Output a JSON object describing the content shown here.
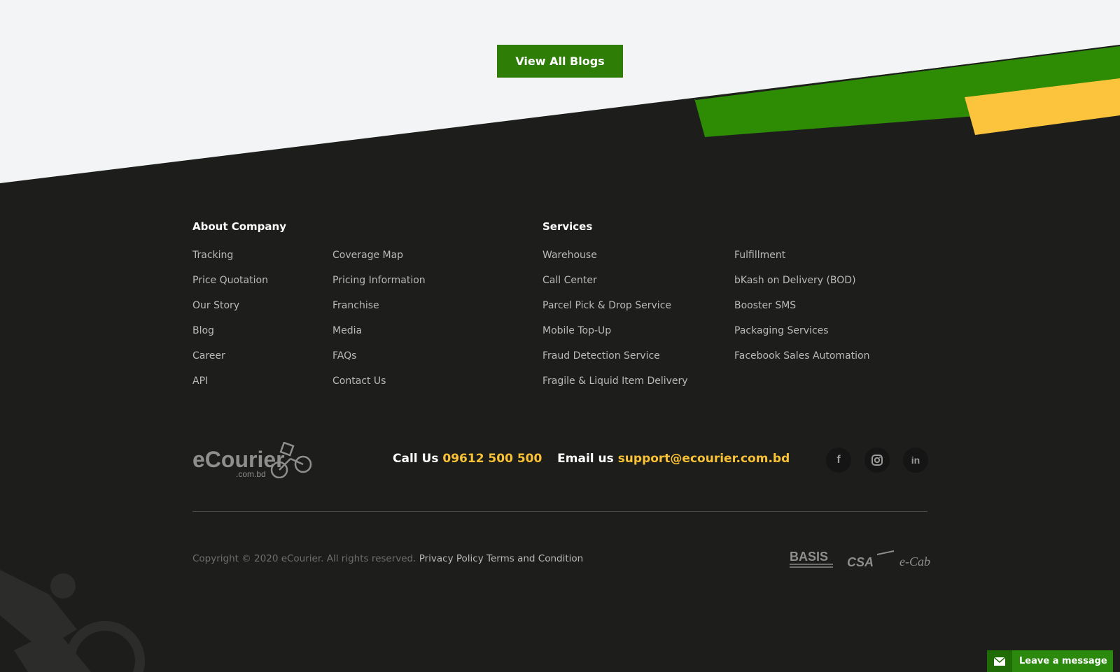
{
  "top_button": {
    "label": "View All Blogs"
  },
  "about": {
    "heading": "About Company",
    "col1": [
      "Tracking",
      "Price Quotation",
      "Our Story",
      "Blog",
      "Career",
      "API"
    ],
    "col2": [
      "Coverage Map",
      "Pricing Information",
      "Franchise",
      "Media",
      "FAQs",
      "Contact Us"
    ]
  },
  "services": {
    "heading": "Services",
    "col1": [
      "Warehouse",
      "Call Center",
      "Parcel Pick & Drop Service",
      "Mobile Top-Up",
      "Fraud Detection Service",
      "Fragile & Liquid Item Delivery"
    ],
    "col2": [
      "Fulfillment",
      "bKash on Delivery (BOD)",
      "Booster SMS",
      "Packaging Services",
      "Facebook Sales Automation"
    ]
  },
  "logo": {
    "main": "eCourier",
    "sub": ".com.bd"
  },
  "contact": {
    "call_label": "Call Us",
    "phone": "09612 500 500",
    "email_label": "Email us",
    "email": "support@ecourier.com.bd"
  },
  "social": {
    "icons": [
      "facebook-icon",
      "instagram-icon",
      "linkedin-icon"
    ]
  },
  "footer": {
    "copyright": "Copyright © 2020 eCourier. All rights reserved.",
    "privacy": "Privacy Policy",
    "terms": "Terms and Condition"
  },
  "partners": {
    "basis": "BASIS",
    "csa": "CSA",
    "ecab": "e-Cab"
  },
  "chat_widget": {
    "label": "Leave a message"
  },
  "colors": {
    "green": "#2d7d06",
    "yellow": "#f9c134",
    "dark": "#1d1e1c",
    "light": "#f3f4f6"
  }
}
